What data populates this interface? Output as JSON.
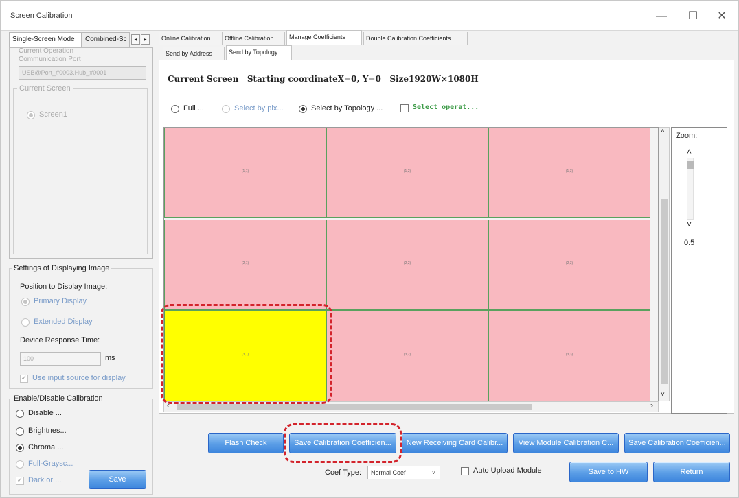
{
  "window": {
    "title": "Screen Calibration",
    "minimize": "—",
    "maximize": "☐",
    "close": "✕"
  },
  "left": {
    "tabs": [
      "Single-Screen Mode",
      "Combined-Sc"
    ],
    "tab_prev": "◂",
    "tab_next": "▸",
    "current_operation": "Current Operation",
    "communication_port": "Communication Port",
    "port_value": "USB@Port_#0003.Hub_#0001",
    "current_screen": "Current Screen",
    "screen1": "Screen1",
    "settings_title": "Settings of Displaying Image",
    "position_label": "Position to Display Image:",
    "primary_display": "Primary Display",
    "extended_display": "Extended Display",
    "response_time_label": "Device Response Time:",
    "response_time_value": "100",
    "response_time_unit": "ms",
    "use_input_source": "Use input source for display",
    "calibration_title": "Enable/Disable Calibration",
    "disable": "Disable ...",
    "brightness": "Brightnes...",
    "chroma": "Chroma ...",
    "full_grayscale": "Full-Graysc...",
    "dark": "Dark or ...",
    "save": "Save"
  },
  "tabs": {
    "main": [
      "Online Calibration",
      "Offline Calibration",
      "Manage Coefficients",
      "Double Calibration Coefficients"
    ],
    "sub": [
      "Send by Address",
      "Send by Topology"
    ]
  },
  "screen_info": "Current Screen   Starting coordinateX=0, Y=0   Size1920W×1080H",
  "select": {
    "full": "Full ...",
    "by_pixel": "Select by pix...",
    "by_topology": "Select by Topology ...",
    "operat": "Select operat..."
  },
  "grid": {
    "rows": [
      [
        "(1,1)",
        "(1,2)",
        "(1,3)"
      ],
      [
        "(2,1)",
        "(2,2)",
        "(2,3)"
      ],
      [
        "(3,1)",
        "(3,2)",
        "(3,3)"
      ]
    ],
    "selected_row": 2,
    "selected_col": 0
  },
  "scroll": {
    "up": "˄",
    "down": "˅",
    "left": "‹",
    "right": "›"
  },
  "zoom": {
    "label": "Zoom:",
    "value": "0.5",
    "up": "˄",
    "down": "˅"
  },
  "buttons": {
    "flash_check": "Flash Check",
    "save_calib_1": "Save Calibration Coefficien...",
    "new_receiving": "New Receiving Card Calibr...",
    "view_module": "View Module Calibration C...",
    "save_calib_2": "Save Calibration Coefficien...",
    "save_hw": "Save to HW",
    "return": "Return"
  },
  "coef": {
    "label": "Coef Type:",
    "value": "Normal Coef",
    "auto_upload": "Auto Upload Module"
  },
  "colors": {
    "cell_pink": "#f9b9c0",
    "cell_selected": "#ffff00",
    "grid_line": "#5aa15e",
    "highlight_dash": "#d3242c",
    "button_blue": "#4a8fe0"
  }
}
